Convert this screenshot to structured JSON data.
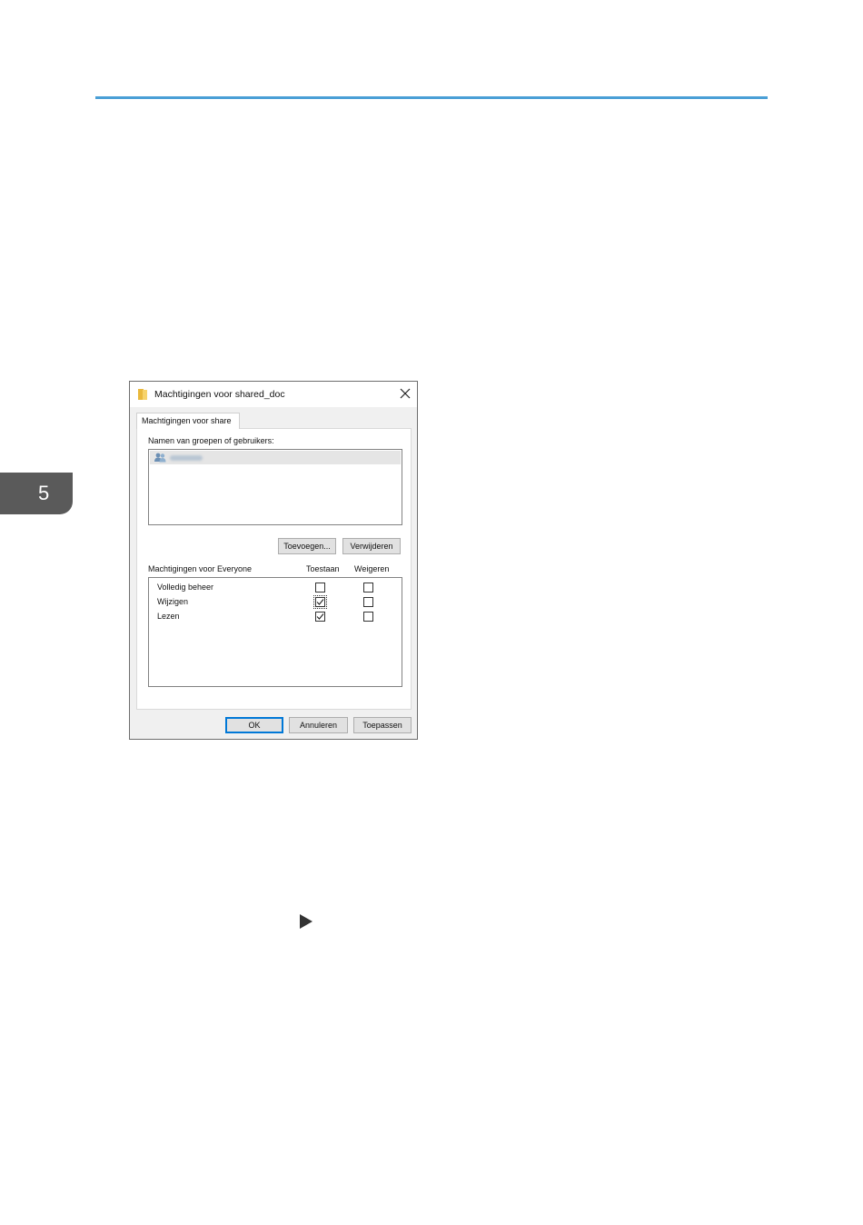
{
  "page": {
    "chapter_number": "5"
  },
  "dialog": {
    "title": "Machtigingen voor shared_doc",
    "tab_label": "Machtigingen voor share",
    "groups_label": "Namen van groepen of gebruikers:",
    "groups": [
      {
        "name": "Everyone",
        "selected": true
      }
    ],
    "add_button": "Toevoegen...",
    "remove_button": "Verwijderen",
    "permissions_label": "Machtigingen voor Everyone",
    "allow_header": "Toestaan",
    "deny_header": "Weigeren",
    "permissions": [
      {
        "name": "Volledig beheer",
        "allow": false,
        "deny": false
      },
      {
        "name": "Wijzigen",
        "allow": true,
        "deny": false
      },
      {
        "name": "Lezen",
        "allow": true,
        "deny": false
      }
    ],
    "ok_button": "OK",
    "cancel_button": "Annuleren",
    "apply_button": "Toepassen"
  },
  "colors": {
    "accent_rule": "#4a9fd6",
    "chapter_tab": "#5a5a5a",
    "primary_button_border": "#0078d7"
  },
  "icons": [
    "folder-icon",
    "close-icon",
    "users-icon",
    "check-icon",
    "play-arrow-icon"
  ]
}
